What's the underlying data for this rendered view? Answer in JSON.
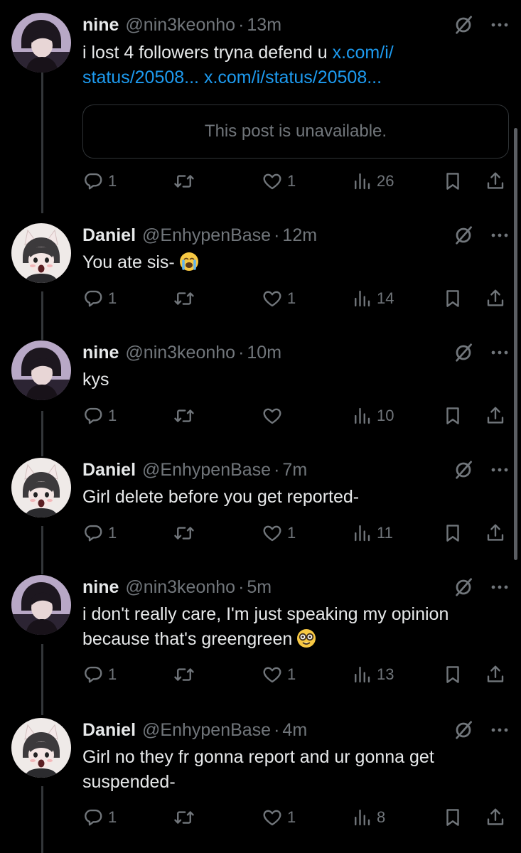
{
  "tweets": [
    {
      "name": "nine",
      "handle": "@nin3keonho",
      "time": "13m",
      "text": "i lost 4 followers tryna defend u ",
      "link1": "x.com/i/",
      "link2": "status/20508... x.com/i/status/20508...",
      "quote": "This post is unavailable.",
      "replies": "1",
      "reposts": "",
      "likes": "1",
      "views": "26",
      "avatar": "nine"
    },
    {
      "name": "Daniel",
      "handle": "@EnhypenBase",
      "time": "12m",
      "text": "You ate sis-",
      "emoji": "loudly-crying-face-emoji",
      "replies": "1",
      "reposts": "",
      "likes": "1",
      "views": "14",
      "avatar": "daniel"
    },
    {
      "name": "nine",
      "handle": "@nin3keonho",
      "time": "10m",
      "text": "kys",
      "replies": "1",
      "reposts": "",
      "likes": "",
      "views": "10",
      "avatar": "nine"
    },
    {
      "name": "Daniel",
      "handle": "@EnhypenBase",
      "time": "7m",
      "text": "Girl delete before you get reported-",
      "replies": "1",
      "reposts": "",
      "likes": "1",
      "views": "11",
      "avatar": "daniel"
    },
    {
      "name": "nine",
      "handle": "@nin3keonho",
      "time": "5m",
      "text1": "i don't really care, I'm just speaking my opinion",
      "text2": "because that's greengreen",
      "emoji": "nerd-face-emoji",
      "replies": "1",
      "reposts": "",
      "likes": "1",
      "views": "13",
      "avatar": "nine"
    },
    {
      "name": "Daniel",
      "handle": "@EnhypenBase",
      "time": "4m",
      "text1": "Girl no they fr gonna report and ur gonna get",
      "text2": "suspended-",
      "replies": "1",
      "reposts": "",
      "likes": "1",
      "views": "8",
      "avatar": "daniel"
    }
  ],
  "separator": "·",
  "colors": {
    "background": "#000000",
    "text": "#e7e9ea",
    "secondary": "#71767b",
    "link": "#1d9bf0",
    "border": "#2f3336"
  }
}
